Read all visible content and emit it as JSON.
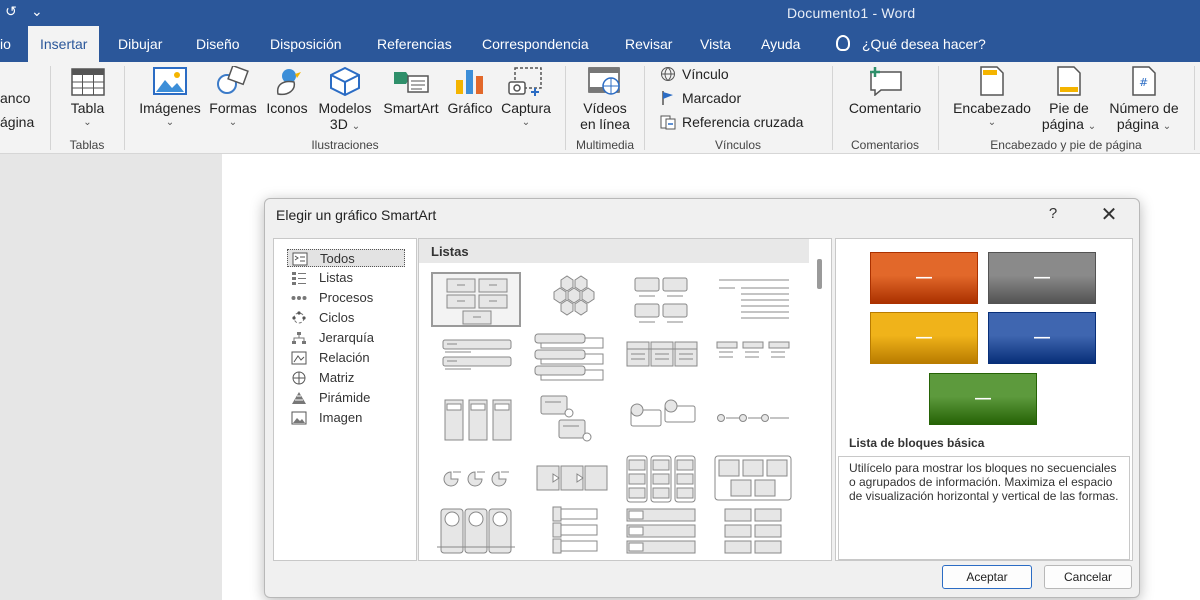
{
  "window": {
    "title": "Documento1  -  Word",
    "qat_autosave_icon": "undo-icon",
    "qat_more": "⌄"
  },
  "tabs": [
    {
      "label": "io",
      "active": false
    },
    {
      "label": "Insertar",
      "active": true
    },
    {
      "label": "Dibujar",
      "active": false
    },
    {
      "label": "Diseño",
      "active": false
    },
    {
      "label": "Disposición",
      "active": false
    },
    {
      "label": "Referencias",
      "active": false
    },
    {
      "label": "Correspondencia",
      "active": false
    },
    {
      "label": "Revisar",
      "active": false
    },
    {
      "label": "Vista",
      "active": false
    },
    {
      "label": "Ayuda",
      "active": false
    }
  ],
  "tell_me": "¿Qué desea hacer?",
  "ribbon": {
    "blank_page": {
      "line1": "anco",
      "line2": "ágina"
    },
    "table": {
      "label": "Tabla",
      "group": "Tablas"
    },
    "illustrations": {
      "group": "Ilustraciones",
      "images": "Imágenes",
      "shapes": "Formas",
      "icons": "Iconos",
      "models_line1": "Modelos",
      "models_line2": "3D",
      "smartart": "SmartArt",
      "chart": "Gráfico",
      "capture": "Captura"
    },
    "multimedia": {
      "group": "Multimedia",
      "line1": "Vídeos",
      "line2": "en línea"
    },
    "links": {
      "group": "Vínculos",
      "link": "Vínculo",
      "bookmark": "Marcador",
      "cross_ref": "Referencia cruzada"
    },
    "comments": {
      "group": "Comentarios",
      "comment": "Comentario"
    },
    "header_footer": {
      "group": "Encabezado y pie de página",
      "header": "Encabezado",
      "footer_line1": "Pie de",
      "footer_line2": "página",
      "page_num_line1": "Número de",
      "page_num_line2": "página"
    },
    "chevron": "⌄"
  },
  "dialog": {
    "title": "Elegir un gráfico SmartArt",
    "help": "?",
    "close": "✕",
    "categories": [
      {
        "label": "Todos",
        "icon": "all-icon",
        "selected": true
      },
      {
        "label": "Listas",
        "icon": "list-icon",
        "selected": false
      },
      {
        "label": "Procesos",
        "icon": "process-icon",
        "selected": false
      },
      {
        "label": "Ciclos",
        "icon": "cycle-icon",
        "selected": false
      },
      {
        "label": "Jerarquía",
        "icon": "hierarchy-icon",
        "selected": false
      },
      {
        "label": "Relación",
        "icon": "relationship-icon",
        "selected": false
      },
      {
        "label": "Matriz",
        "icon": "matrix-icon",
        "selected": false
      },
      {
        "label": "Pirámide",
        "icon": "pyramid-icon",
        "selected": false
      },
      {
        "label": "Imagen",
        "icon": "picture-icon",
        "selected": false
      }
    ],
    "gallery_header": "Listas",
    "gallery_layouts": [
      "basic-block-list",
      "hexagon-cluster",
      "grouped-boxes-list",
      "lined-list",
      "vertical-bullet-list",
      "stacked-list",
      "table-list",
      "horizontal-bullet-list",
      "vertical-box-list",
      "picture-caption-list",
      "circle-accent-list",
      "bullet-dots-list",
      "pie-accent-list",
      "chevron-list",
      "tab-list",
      "framed-block-list",
      "picture-column-list",
      "tall-tab-list",
      "labeled-stack-list",
      "block-grid-list"
    ],
    "preview": {
      "colors": {
        "orange": "#e2682a",
        "gray": "#8a8a8a",
        "gold": "#f0b31a",
        "blue": "#3f66b0",
        "green": "#5d9a3d"
      },
      "block_text": "—",
      "name": "Lista de bloques básica",
      "description": "Utilícelo para mostrar los bloques no secuenciales o agrupados de información. Maximiza el espacio de visualización horizontal y vertical de las formas."
    },
    "ok": "Aceptar",
    "cancel": "Cancelar"
  }
}
